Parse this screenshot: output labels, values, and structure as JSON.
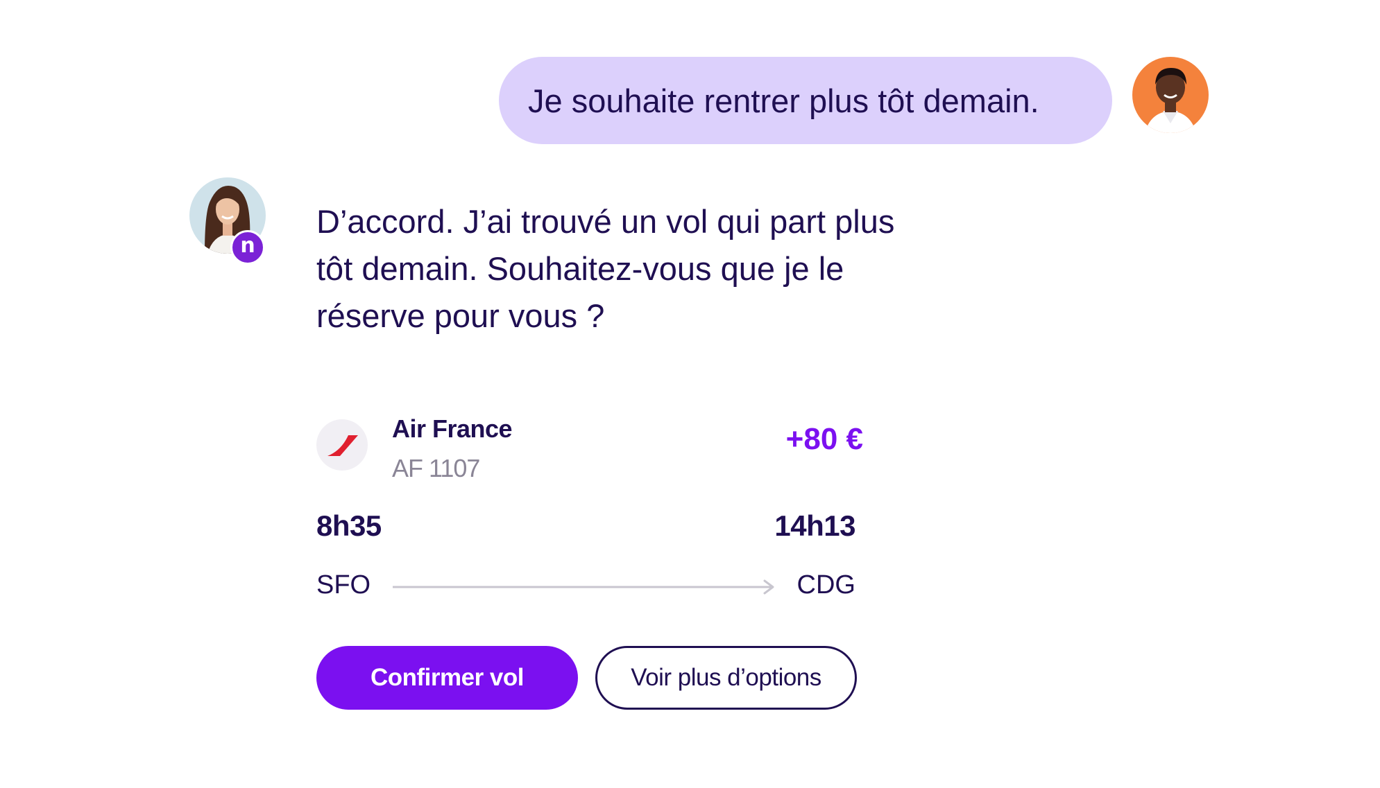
{
  "conversation": {
    "user_message": "Je souhaite rentrer plus tôt demain.",
    "assistant_message": "D’accord. J’ai trouvé un vol qui part plus tôt demain. Souhaitez-vous que je le réserve pour vous ?",
    "assistant_badge": "n"
  },
  "flight": {
    "airline": "Air France",
    "flight_number": "AF 1107",
    "price_delta": "+80 €",
    "departure_time": "8h35",
    "arrival_time": "14h13",
    "origin": "SFO",
    "destination": "CDG"
  },
  "actions": {
    "confirm_label": "Confirmer vol",
    "more_options_label": "Voir plus d’options"
  },
  "colors": {
    "user_bubble": "#dcd0fc",
    "text_primary": "#1f0f52",
    "accent": "#7b10f0",
    "muted": "#8a8596",
    "user_avatar_bg": "#f4823c",
    "airline_logo_red": "#e0202f"
  },
  "icons": {
    "user_avatar": "user-avatar",
    "assistant_avatar": "assistant-avatar",
    "airline_logo": "air-france-logo-icon",
    "route_arrow": "arrow-right-icon"
  }
}
